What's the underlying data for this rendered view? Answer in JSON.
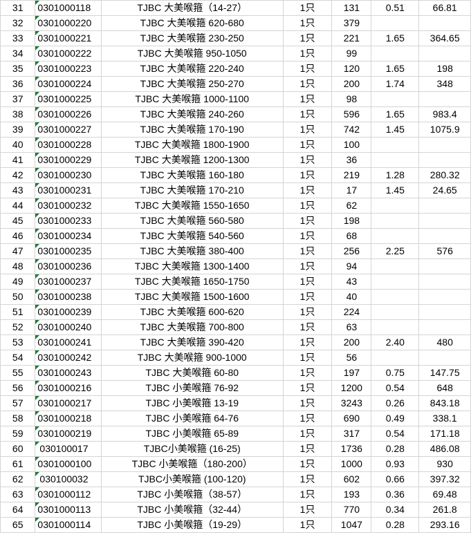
{
  "rows": [
    {
      "no": "31",
      "code": "0301000118",
      "name": "TJBC 大美喉箍（14-27）",
      "unit": "1只",
      "qty": "131",
      "price": "0.51",
      "amount": "66.81"
    },
    {
      "no": "32",
      "code": "0301000220",
      "name": "TJBC 大美喉箍 620-680",
      "unit": "1只",
      "qty": "379",
      "price": "",
      "amount": ""
    },
    {
      "no": "33",
      "code": "0301000221",
      "name": "TJBC 大美喉箍 230-250",
      "unit": "1只",
      "qty": "221",
      "price": "1.65",
      "amount": "364.65"
    },
    {
      "no": "34",
      "code": "0301000222",
      "name": "TJBC 大美喉箍 950-1050",
      "unit": "1只",
      "qty": "99",
      "price": "",
      "amount": ""
    },
    {
      "no": "35",
      "code": "0301000223",
      "name": "TJBC 大美喉箍 220-240",
      "unit": "1只",
      "qty": "120",
      "price": "1.65",
      "amount": "198"
    },
    {
      "no": "36",
      "code": "0301000224",
      "name": "TJBC 大美喉箍 250-270",
      "unit": "1只",
      "qty": "200",
      "price": "1.74",
      "amount": "348"
    },
    {
      "no": "37",
      "code": "0301000225",
      "name": "TJBC 大美喉箍 1000-1100",
      "unit": "1只",
      "qty": "98",
      "price": "",
      "amount": ""
    },
    {
      "no": "38",
      "code": "0301000226",
      "name": "TJBC 大美喉箍 240-260",
      "unit": "1只",
      "qty": "596",
      "price": "1.65",
      "amount": "983.4"
    },
    {
      "no": "39",
      "code": "0301000227",
      "name": "TJBC 大美喉箍 170-190",
      "unit": "1只",
      "qty": "742",
      "price": "1.45",
      "amount": "1075.9"
    },
    {
      "no": "40",
      "code": "0301000228",
      "name": "TJBC 大美喉箍 1800-1900",
      "unit": "1只",
      "qty": "100",
      "price": "",
      "amount": ""
    },
    {
      "no": "41",
      "code": "0301000229",
      "name": "TJBC 大美喉箍 1200-1300",
      "unit": "1只",
      "qty": "36",
      "price": "",
      "amount": ""
    },
    {
      "no": "42",
      "code": "0301000230",
      "name": "TJBC 大美喉箍 160-180",
      "unit": "1只",
      "qty": "219",
      "price": "1.28",
      "amount": "280.32"
    },
    {
      "no": "43",
      "code": "0301000231",
      "name": "TJBC 大美喉箍 170-210",
      "unit": "1只",
      "qty": "17",
      "price": "1.45",
      "amount": "24.65"
    },
    {
      "no": "44",
      "code": "0301000232",
      "name": "TJBC 大美喉箍 1550-1650",
      "unit": "1只",
      "qty": "62",
      "price": "",
      "amount": ""
    },
    {
      "no": "45",
      "code": "0301000233",
      "name": "TJBC 大美喉箍 560-580",
      "unit": "1只",
      "qty": "198",
      "price": "",
      "amount": ""
    },
    {
      "no": "46",
      "code": "0301000234",
      "name": "TJBC 大美喉箍 540-560",
      "unit": "1只",
      "qty": "68",
      "price": "",
      "amount": ""
    },
    {
      "no": "47",
      "code": "0301000235",
      "name": "TJBC 大美喉箍 380-400",
      "unit": "1只",
      "qty": "256",
      "price": "2.25",
      "amount": "576"
    },
    {
      "no": "48",
      "code": "0301000236",
      "name": "TJBC 大美喉箍 1300-1400",
      "unit": "1只",
      "qty": "94",
      "price": "",
      "amount": ""
    },
    {
      "no": "49",
      "code": "0301000237",
      "name": "TJBC 大美喉箍 1650-1750",
      "unit": "1只",
      "qty": "43",
      "price": "",
      "amount": ""
    },
    {
      "no": "50",
      "code": "0301000238",
      "name": "TJBC 大美喉箍 1500-1600",
      "unit": "1只",
      "qty": "40",
      "price": "",
      "amount": ""
    },
    {
      "no": "51",
      "code": "0301000239",
      "name": "TJBC 大美喉箍 600-620",
      "unit": "1只",
      "qty": "224",
      "price": "",
      "amount": ""
    },
    {
      "no": "52",
      "code": "0301000240",
      "name": "TJBC 大美喉箍 700-800",
      "unit": "1只",
      "qty": "63",
      "price": "",
      "amount": ""
    },
    {
      "no": "53",
      "code": "0301000241",
      "name": "TJBC 大美喉箍 390-420",
      "unit": "1只",
      "qty": "200",
      "price": "2.40",
      "amount": "480"
    },
    {
      "no": "54",
      "code": "0301000242",
      "name": "TJBC 大美喉箍 900-1000",
      "unit": "1只",
      "qty": "56",
      "price": "",
      "amount": ""
    },
    {
      "no": "55",
      "code": "0301000243",
      "name": "TJBC 大美喉箍 60-80",
      "unit": "1只",
      "qty": "197",
      "price": "0.75",
      "amount": "147.75"
    },
    {
      "no": "56",
      "code": "0301000216",
      "name": "TJBC 小美喉箍 76-92",
      "unit": "1只",
      "qty": "1200",
      "price": "0.54",
      "amount": "648"
    },
    {
      "no": "57",
      "code": "0301000217",
      "name": "TJBC 小美喉箍 13-19",
      "unit": "1只",
      "qty": "3243",
      "price": "0.26",
      "amount": "843.18"
    },
    {
      "no": "58",
      "code": "0301000218",
      "name": "TJBC 小美喉箍 64-76",
      "unit": "1只",
      "qty": "690",
      "price": "0.49",
      "amount": "338.1"
    },
    {
      "no": "59",
      "code": "0301000219",
      "name": "TJBC 小美喉箍 65-89",
      "unit": "1只",
      "qty": "317",
      "price": "0.54",
      "amount": "171.18"
    },
    {
      "no": "60",
      "code": "030100017",
      "name": "TJBC小美喉箍 (16-25)",
      "unit": "1只",
      "qty": "1736",
      "price": "0.28",
      "amount": "486.08"
    },
    {
      "no": "61",
      "code": "0301000100",
      "name": "TJBC 小美喉箍（180-200）",
      "unit": "1只",
      "qty": "1000",
      "price": "0.93",
      "amount": "930"
    },
    {
      "no": "62",
      "code": "030100032",
      "name": "TJBC小美喉箍 (100-120)",
      "unit": "1只",
      "qty": "602",
      "price": "0.66",
      "amount": "397.32"
    },
    {
      "no": "63",
      "code": "0301000112",
      "name": "TJBC 小美喉箍（38-57）",
      "unit": "1只",
      "qty": "193",
      "price": "0.36",
      "amount": "69.48"
    },
    {
      "no": "64",
      "code": "0301000113",
      "name": "TJBC 小美喉箍（32-44）",
      "unit": "1只",
      "qty": "770",
      "price": "0.34",
      "amount": "261.8"
    },
    {
      "no": "65",
      "code": "0301000114",
      "name": "TJBC 小美喉箍（19-29）",
      "unit": "1只",
      "qty": "1047",
      "price": "0.28",
      "amount": "293.16"
    }
  ]
}
